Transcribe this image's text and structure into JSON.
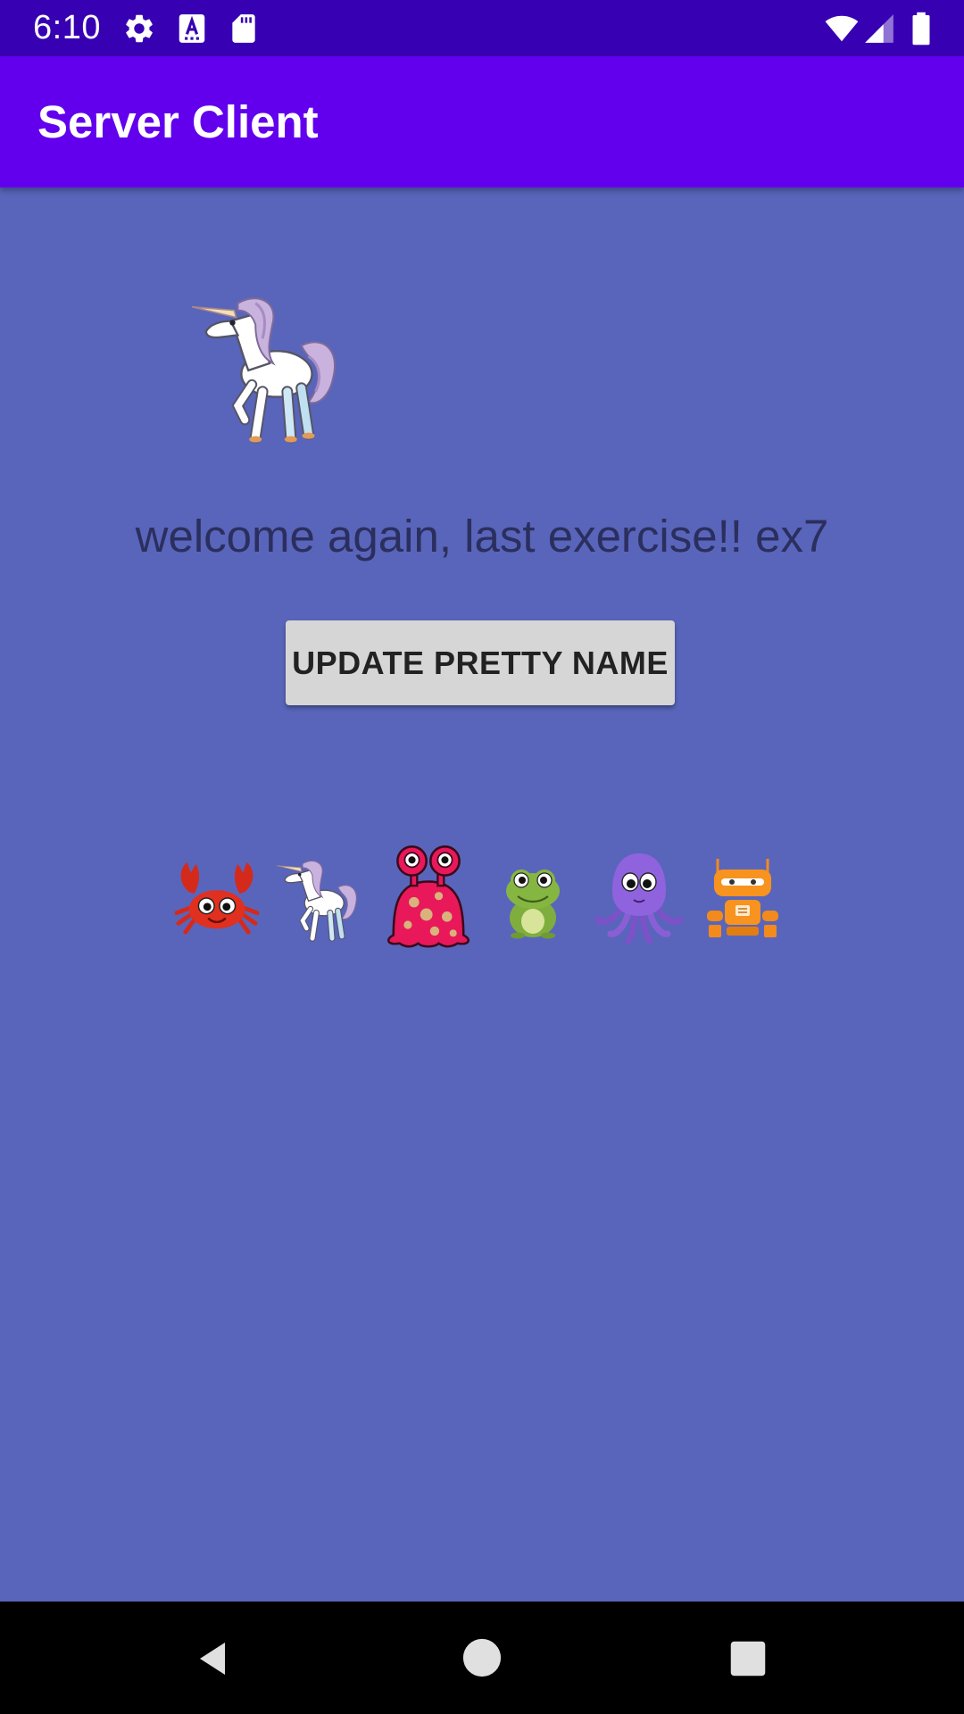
{
  "status_bar": {
    "time": "6:10",
    "left_icons": [
      "gear-icon",
      "text-format-icon",
      "sd-card-icon"
    ],
    "right_icons": [
      "wifi-icon",
      "signal-icon",
      "battery-icon"
    ]
  },
  "app_bar": {
    "title": "Server Client",
    "color": "#6200EE"
  },
  "main": {
    "background_color": "#5965BB",
    "selected_avatar": "unicorn-icon",
    "welcome_text": "welcome again, last exercise!! ex7",
    "update_button_label": "UPDATE PRETTY NAME",
    "avatars": [
      "crab-icon",
      "unicorn-icon",
      "pink-monster-icon",
      "frog-icon",
      "octopus-icon",
      "robot-icon"
    ]
  },
  "nav_bar": {
    "buttons": [
      "back-icon",
      "home-icon",
      "recents-icon"
    ]
  }
}
